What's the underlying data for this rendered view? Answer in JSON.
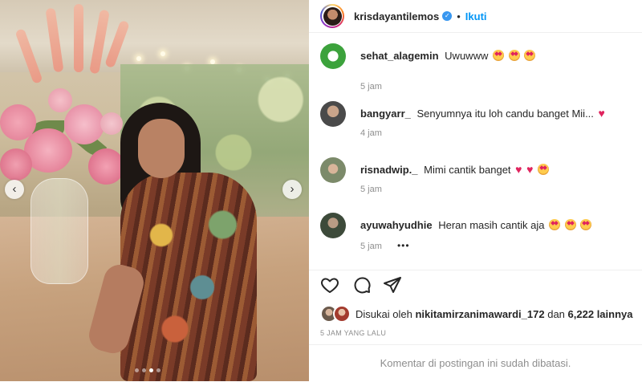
{
  "post": {
    "username": "krisdayantilemos",
    "separator": "•",
    "follow_label": "Ikuti",
    "verified": true
  },
  "comments": [
    {
      "user": "sehat_alagemin",
      "text": "Uwuwww",
      "emojis": [
        "star-eyes",
        "star-eyes",
        "star-eyes"
      ],
      "time": "5 jam"
    },
    {
      "user": "bangyarr_",
      "text": "Senyumnya itu loh candu banget Mii...",
      "emojis": [
        "red-heart"
      ],
      "time": "4 jam"
    },
    {
      "user": "risnadwip._",
      "text": "Mimi cantik banget",
      "emojis": [
        "red-heart",
        "red-heart",
        "star-eyes"
      ],
      "time": "5 jam"
    },
    {
      "user": "ayuwahyudhie",
      "text": "Heran masih cantik aja",
      "emojis": [
        "star-eyes",
        "star-eyes",
        "star-eyes"
      ],
      "time": "5 jam"
    }
  ],
  "likes": {
    "prefix": "Disukai oleh",
    "user": "nikitamirzanimawardi_172",
    "connector": "dan",
    "others": "6,222 lainnya"
  },
  "timestamp": "5 JAM YANG LALU",
  "comments_limited": "Komentar di postingan ini sudah dibatasi.",
  "carousel": {
    "slides": 4,
    "active_index": 2
  },
  "colors": {
    "accent": "#0095f6",
    "muted": "#8e8e8e",
    "heart": "#e0245e"
  }
}
